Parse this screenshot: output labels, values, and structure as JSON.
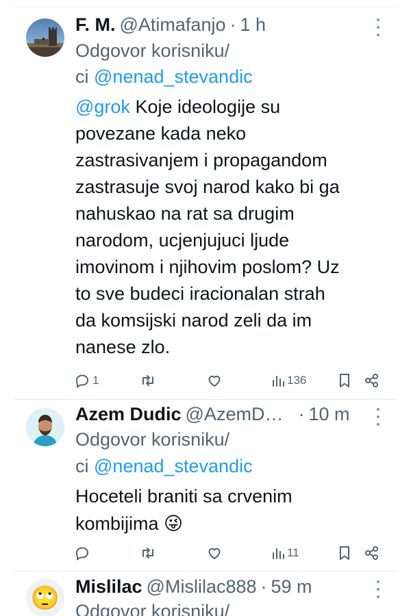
{
  "tweets": [
    {
      "name": "F. M.",
      "handle": "@Atimafanjo",
      "separator": "·",
      "time": "1 h",
      "reply_label": "Odgovor korisniku/",
      "reply_prefix": "ci",
      "reply_to": "@nenad_stevandic",
      "mention": "@grok",
      "body_first": "Koje ideologije su",
      "body_lines": [
        "povezane kada neko",
        "zastrasivanjem i propagandom",
        "zastrasuje svoj narod kako bi ga",
        "nahuskao na rat sa drugim",
        "narodom, ucjenjujuci ljude",
        "imovinom i njihovim poslom? Uz",
        "to sve budeci iracionalan strah",
        "da komsijski narod zeli da im",
        "nanese zlo."
      ],
      "replies": "1",
      "views": "136",
      "icons": [
        "reply-icon",
        "retweet-icon",
        "like-icon",
        "views-icon",
        "bookmark-icon",
        "share-icon"
      ]
    },
    {
      "name": "Azem Dudic",
      "handle": "@AzemD…",
      "separator": "·",
      "time": "10 m",
      "reply_label": "Odgovor korisniku/",
      "reply_prefix": "ci",
      "reply_to": "@nenad_stevandic",
      "body_lines": [
        "Hoceteli braniti sa crvenim"
      ],
      "body_last": "kombijima",
      "emoji": "😜",
      "views": "11"
    },
    {
      "name": "Mislilac",
      "handle": "@Mislilac888",
      "separator": "·",
      "time": "59 m",
      "reply_label": "Odgovor korisniku/",
      "emoji_avatar": "🙄"
    }
  ],
  "colors": {
    "text": "#0f1419",
    "secondary": "#536471",
    "link": "#1d9bf0",
    "divider": "#e7e9ea"
  }
}
